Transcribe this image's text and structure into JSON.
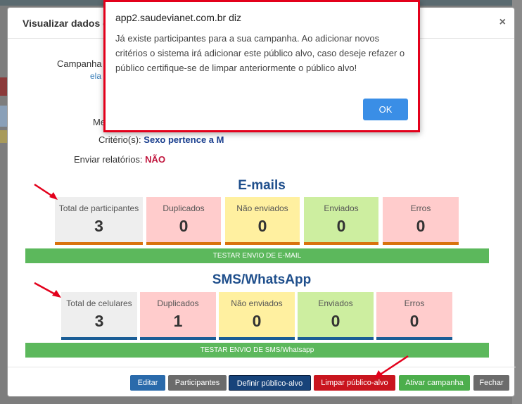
{
  "modal": {
    "title": "Visualizar dados d",
    "close_glyph": "×",
    "campaign_label": "Campanha 2",
    "campaign_link": "ela",
    "me_label": "Me",
    "criteria_label": "Critério(s):",
    "criteria_value": "Sexo pertence a M",
    "reports_label": "Enviar relatórios:",
    "reports_value": "NÃO"
  },
  "emails": {
    "title": "E-mails",
    "boxes": [
      {
        "label": "Total de participantes",
        "value": "3",
        "bg": "#eeeeee",
        "bar": "#d9730d"
      },
      {
        "label": "Duplicados",
        "value": "0",
        "bg": "#ffcccc",
        "bar": "#d9730d"
      },
      {
        "label": "Não enviados",
        "value": "0",
        "bg": "#fff0a0",
        "bar": "#d9730d"
      },
      {
        "label": "Enviados",
        "value": "0",
        "bg": "#cdeea0",
        "bar": "#d9730d"
      },
      {
        "label": "Erros",
        "value": "0",
        "bg": "#ffcccc",
        "bar": "#d9730d"
      }
    ],
    "test_button": "TESTAR ENVIO DE E-MAIL"
  },
  "sms": {
    "title": "SMS/WhatsApp",
    "boxes": [
      {
        "label": "Total de celulares",
        "value": "3",
        "bg": "#eeeeee",
        "bar": "#1a5d96"
      },
      {
        "label": "Duplicados",
        "value": "1",
        "bg": "#ffcccc",
        "bar": "#1a5d96"
      },
      {
        "label": "Não enviados",
        "value": "0",
        "bg": "#fff0a0",
        "bar": "#1a5d96"
      },
      {
        "label": "Enviados",
        "value": "0",
        "bg": "#cdeea0",
        "bar": "#1a5d96"
      },
      {
        "label": "Erros",
        "value": "0",
        "bg": "#ffcccc",
        "bar": "#1a5d96"
      }
    ],
    "test_button": "TESTAR ENVIO DE SMS/Whatsapp"
  },
  "footer": {
    "edit": "Editar",
    "participants": "Participantes",
    "define": "Definir público-alvo",
    "clear": "Limpar público-alvo",
    "activate": "Ativar campanha",
    "close": "Fechar"
  },
  "alert": {
    "title": "app2.saudevianet.com.br diz",
    "message": "Já existe participantes para a sua campanha. Ao adicionar novos critérios o sistema irá adicionar este público alvo, caso deseje refazer o público certifique-se de limpar anteriormente o público alvo!",
    "ok": "OK"
  },
  "colors": {
    "accent_blue": "#1f4f8c",
    "arrow_red": "#e3001b",
    "ok_blue": "#3a8ee6",
    "green": "#5cb85c"
  }
}
